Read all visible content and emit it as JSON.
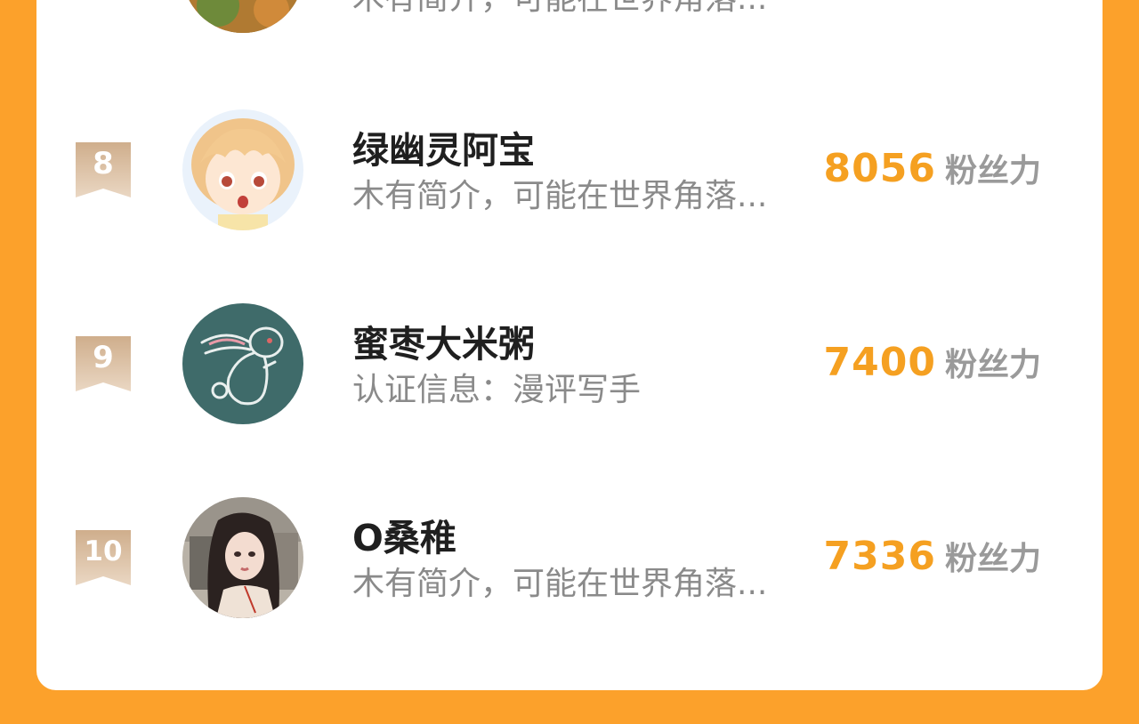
{
  "ranking": {
    "score_unit": "粉丝力",
    "partial_row": {
      "desc": "木有简介，可能在世界角落..."
    },
    "rows": [
      {
        "rank": "8",
        "name": "绿幽灵阿宝",
        "desc": "木有简介，可能在世界角落...",
        "score": "8056",
        "avatar": "anime-boy-avatar"
      },
      {
        "rank": "9",
        "name": "蜜枣大米粥",
        "desc": "认证信息：漫评写手",
        "score": "7400",
        "avatar": "chalk-rabbit-avatar"
      },
      {
        "rank": "10",
        "name": "O桑稚",
        "desc": "木有简介，可能在世界角落...",
        "score": "7336",
        "avatar": "girl-portrait-avatar"
      }
    ]
  },
  "colors": {
    "background": "#fca12b",
    "card": "#ffffff",
    "score": "#f5a021",
    "rank_badge": "#d9b999"
  }
}
